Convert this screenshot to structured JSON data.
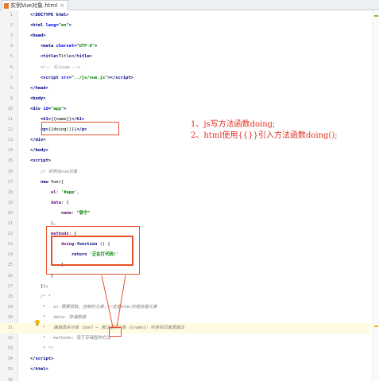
{
  "tab": {
    "title": "实例Vue对象.html",
    "close": "×"
  },
  "lines": [
    {
      "n": "1",
      "html": "<span class='tag'>&lt;!DOCTYPE html&gt;</span>"
    },
    {
      "n": "2",
      "html": "<span class='tag'>&lt;html </span><span class='attr'>lang</span><span class='tag'>=</span><span class='str'>\"en\"</span><span class='tag'>&gt;</span>"
    },
    {
      "n": "3",
      "html": "<span class='tag'>&lt;head&gt;</span>"
    },
    {
      "n": "4",
      "html": "    <span class='tag'>&lt;meta </span><span class='attr'>charset</span><span class='tag'>=</span><span class='str'>\"UTF-8\"</span><span class='tag'>&gt;</span>"
    },
    {
      "n": "5",
      "html": "    <span class='tag'>&lt;title&gt;</span><span class='plain'>Title</span><span class='tag'>&lt;/title&gt;</span>"
    },
    {
      "n": "6",
      "html": "    <span class='cm'>&lt;!-- 引入vue --&gt;</span>"
    },
    {
      "n": "7",
      "html": "    <span class='tag'>&lt;script </span><span class='attr'>src</span><span class='tag'>=</span><span class='str'>\"../js/vue.js\"</span><span class='tag'>&gt;&lt;/script&gt;</span>"
    },
    {
      "n": "8",
      "html": "<span class='tag'>&lt;/head&gt;</span>"
    },
    {
      "n": "9",
      "html": "<span class='tag'>&lt;body&gt;</span>"
    },
    {
      "n": "10",
      "html": "<span class='tag'>&lt;div </span><span class='attr'>id</span><span class='tag'>=</span><span class='str'>\"app\"</span><span class='tag'>&gt;</span>"
    },
    {
      "n": "11",
      "html": "    <span class='tag'>&lt;h1&gt;</span><span class='plain'>{{name}}</span><span class='tag'>&lt;/h1&gt;</span>"
    },
    {
      "n": "12",
      "html": "    <span class='tag'>&lt;p&gt;</span><span class='plain'>{{doing()}}</span><span class='tag'>&lt;/p&gt;</span>"
    },
    {
      "n": "13",
      "html": "<span class='tag'>&lt;/div&gt;</span>"
    },
    {
      "n": "14",
      "html": "<span class='tag'>&lt;/body&gt;</span>"
    },
    {
      "n": "15",
      "html": "<span class='tag'>&lt;script&gt;</span>"
    },
    {
      "n": "16",
      "html": "    <span class='cm'>// 实例化vue对象</span>"
    },
    {
      "n": "17",
      "html": "    <span class='kw'>new </span><span class='plain'>Vue({</span>"
    },
    {
      "n": "18",
      "html": "        <span class='key'>el</span><span class='plain'>: </span><span class='str'>'#app'</span><span class='plain'>,</span>"
    },
    {
      "n": "19",
      "html": "        <span class='key'>data</span><span class='plain'>: {</span>"
    },
    {
      "n": "20",
      "html": "            <span class='key'>name</span><span class='plain'>: </span><span class='str'>\"软宁\"</span>"
    },
    {
      "n": "21",
      "html": "        <span class='plain'>},</span>"
    },
    {
      "n": "22",
      "html": "        <span class='key'>methods</span><span class='plain'>: {</span>"
    },
    {
      "n": "23",
      "html": "            <span class='key'>doing</span><span class='plain'>:</span><span class='kw'>function </span><span class='plain'>() {</span>"
    },
    {
      "n": "24",
      "html": "                <span class='kw'>return </span><span class='str'>'正在打代码!'</span>"
    },
    {
      "n": "25",
      "html": "            <span class='plain'>}</span>"
    },
    {
      "n": "26",
      "html": "        <span class='plain'>}</span>"
    },
    {
      "n": "27",
      "html": "    <span class='plain'>});</span>"
    },
    {
      "n": "28",
      "html": "    <span class='cm'>/* * </span>"
    },
    {
      "n": "29",
      "html": "    <span class='cm'> *   el:需要获取，控制的元素，一定是html的根容器元素</span>"
    },
    {
      "n": "30",
      "html": "    <span class='cm'> *   data: 存储数据</span>"
    },
    {
      "n": "31",
      "html": "    <span class='cm'> *   编辑真实对象（dom）→ 通过虚拟对象（{name}）传递到页面里面去</span>"
    },
    {
      "n": "32",
      "html": "    <span class='cm'> *   </span><span class='cmt'>methods: 用于存储各种方法</span>"
    },
    {
      "n": "33",
      "html": "    <span class='cm'> * */</span>"
    },
    {
      "n": "34",
      "html": "<span class='tag'>&lt;/script&gt;</span>"
    },
    {
      "n": "35",
      "html": "<span class='tag'>&lt;/html&gt;</span>"
    },
    {
      "n": "36",
      "html": ""
    }
  ],
  "notes": [
    "1、js写方法函数doing;",
    "2、html使用{{}}引入方法函数doing();"
  ],
  "colors": {
    "annotation": "#e8512a",
    "note_text": "#e03020"
  }
}
